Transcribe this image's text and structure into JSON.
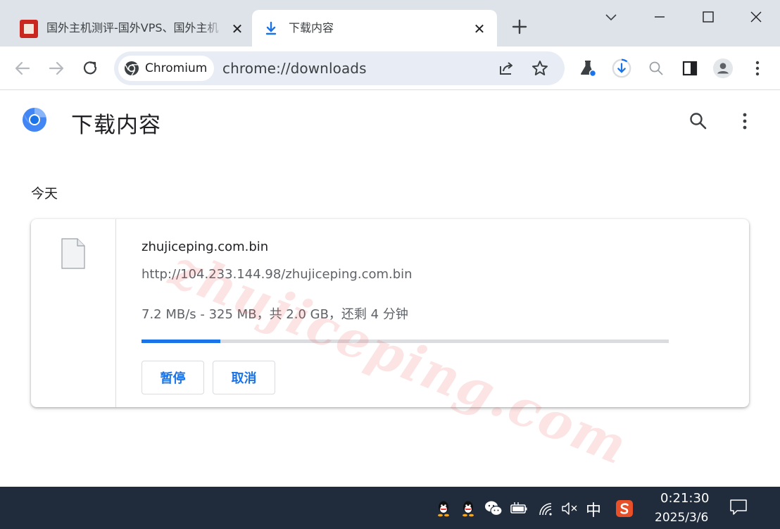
{
  "tabs": [
    {
      "title": "国外主机测评-国外VPS、国外主机",
      "active": false,
      "favicon": "site-seal-favicon"
    },
    {
      "title": "下载内容",
      "active": true,
      "favicon": "download-icon"
    }
  ],
  "window_controls": [
    "tab-search-icon",
    "minimize-icon",
    "maximize-icon",
    "close-icon"
  ],
  "toolbar": {
    "chip_label": "Chromium",
    "url": "chrome://downloads",
    "icons": [
      "back-icon",
      "forward-icon",
      "reload-icon",
      "share-icon",
      "bookmark-star-icon",
      "labs-icon",
      "download-progress-icon",
      "zoom-icon",
      "side-panel-icon",
      "profile-avatar-icon",
      "menu-icon"
    ]
  },
  "page": {
    "title": "下载内容",
    "section": "今天"
  },
  "download": {
    "file_name": "zhujiceping.com.bin",
    "url": "http://104.233.144.98/zhujiceping.com.bin",
    "status": "7.2 MB/s - 325 MB，共 2.0 GB，还剩 4 分钟",
    "progress_fraction": 0.15,
    "pause_label": "暂停",
    "cancel_label": "取消"
  },
  "watermark": "zhujiceping.com",
  "colors": {
    "accent": "#1a73e8",
    "tabstrip": "#dee3ea",
    "taskbar": "#202c3c"
  },
  "taskbar": {
    "ime": "中",
    "time": "0:21:30",
    "date": "2025/3/6",
    "tray_icons": [
      "qq-icon",
      "qq-icon",
      "wechat-icon",
      "battery-icon",
      "wifi-icon",
      "volume-muted-icon",
      "sogou-ime-icon",
      "notification-icon"
    ]
  }
}
